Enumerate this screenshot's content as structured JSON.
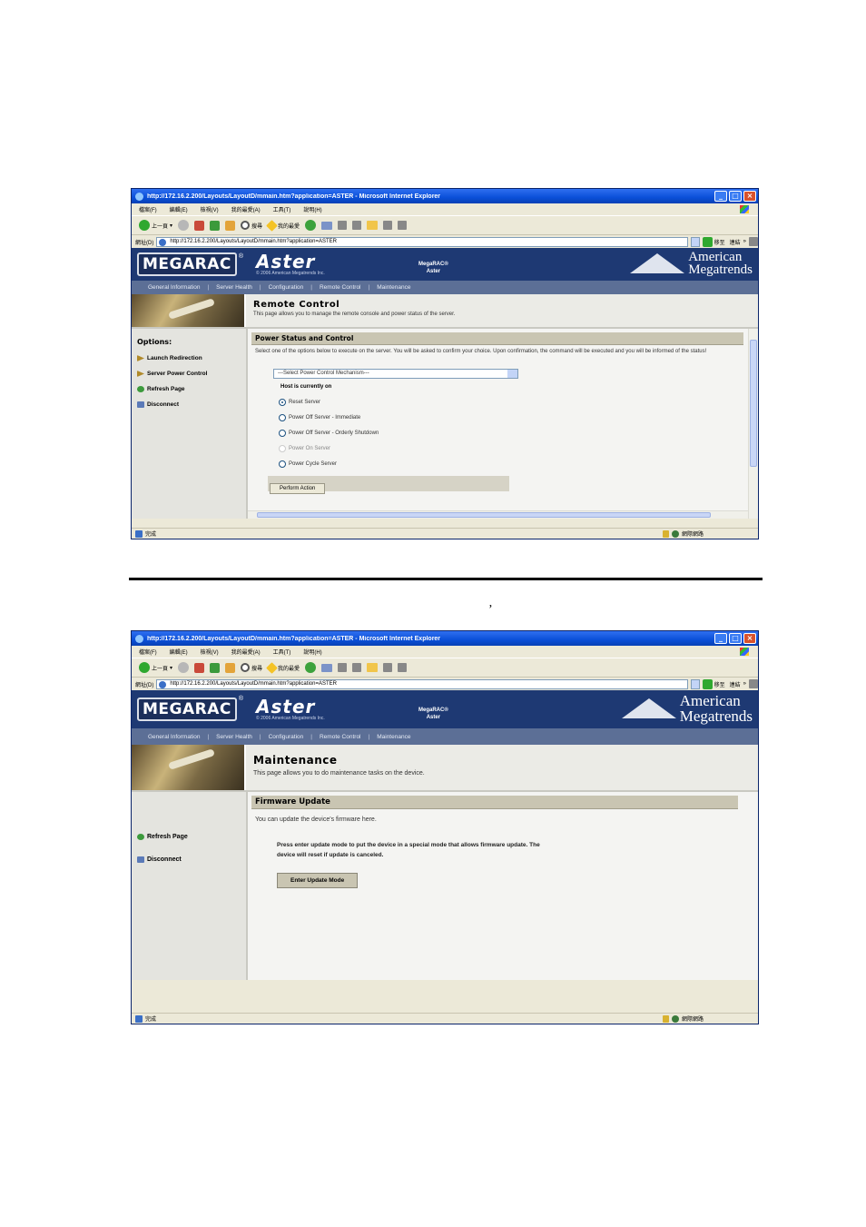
{
  "browser": {
    "title": "http://172.16.2.200/Layouts/LayoutD/mmain.htm?application=ASTER - Microsoft Internet Explorer",
    "menu": [
      "檔案(F)",
      "編輯(E)",
      "檢視(V)",
      "我的最愛(A)",
      "工具(T)",
      "說明(H)"
    ],
    "toolbar": {
      "back": "上一頁",
      "search": "搜尋",
      "favorites": "我的最愛"
    },
    "address_label": "網址(D)",
    "address": "http://172.16.2.200/Layouts/LayoutD/mmain.htm?application=ASTER",
    "go": "移至",
    "links": "連結",
    "status_done": "完成",
    "status_zone": "網際網路"
  },
  "app": {
    "logo": "MEGARAC",
    "reg": "®",
    "product_logo": "Aster",
    "copyright": "© 2006 American Megatrends Inc.",
    "product_line1": "MegaRAC®",
    "product_line2": "Aster",
    "ami_line1": "American",
    "ami_line2": "Megatrends",
    "nav": [
      "General Information",
      "Server Health",
      "Configuration",
      "Remote Control",
      "Maintenance"
    ]
  },
  "remote_control": {
    "title": "Remote Control",
    "description": "This page allows you to manage the remote console and power status of the server.",
    "options_heading": "Options:",
    "sidebar": [
      "Launch Redirection",
      "Server Power Control",
      "Refresh Page",
      "Disconnect"
    ],
    "section_title": "Power Status and Control",
    "section_desc": "Select one of the options below to execute on the server. You will be asked to confirm your choice. Upon confirmation, the command will be executed and you will be informed of the status!",
    "select_value": "---Select Power Control Mechanism---",
    "host_state": "Host is currently on",
    "options": [
      "Reset Server",
      "Power Off Server - Immediate",
      "Power Off Server - Orderly Shutdown",
      "Power On Server",
      "Power Cycle Server"
    ],
    "action_button": "Perform Action"
  },
  "maintenance": {
    "title": "Maintenance",
    "description": "This page allows you to do maintenance tasks on the device.",
    "sidebar": [
      "Refresh Page",
      "Disconnect"
    ],
    "section_title": "Firmware Update",
    "section_desc": "You can update the device's firmware here.",
    "note": "Press enter update mode to put the device in a special mode that allows firmware update. The device will reset if update is canceled.",
    "button": "Enter Update Mode"
  },
  "caption": "’"
}
